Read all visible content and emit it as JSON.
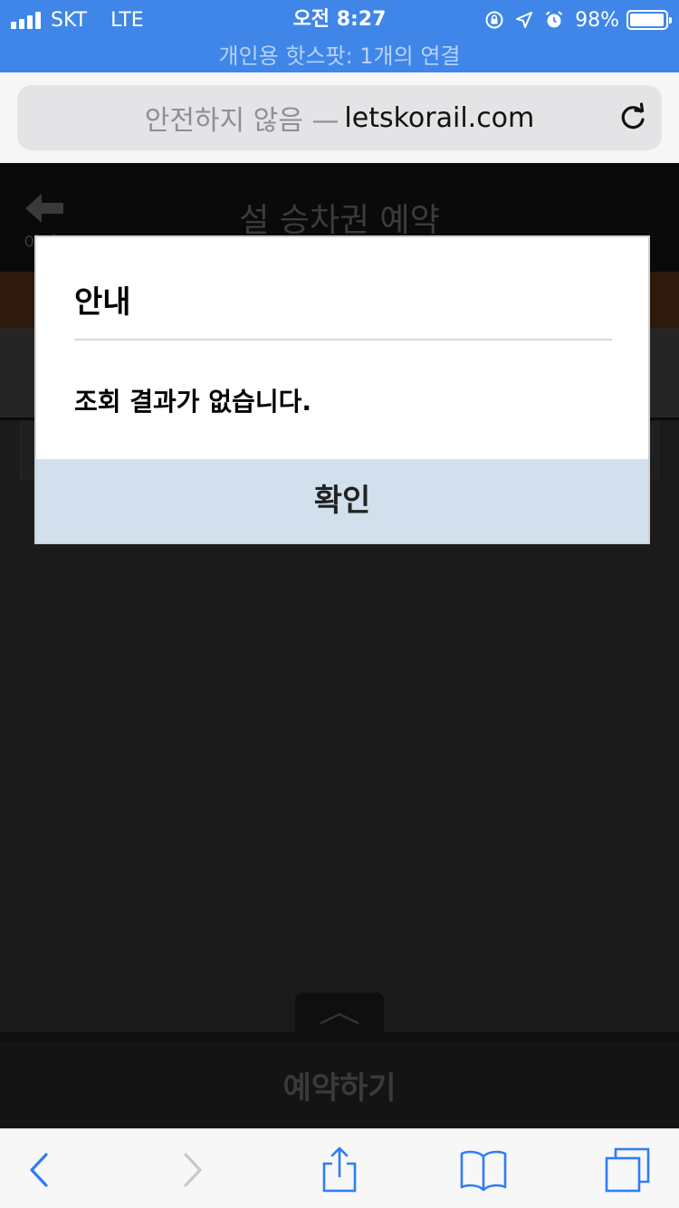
{
  "status_bar": {
    "carrier": "SKT",
    "network": "LTE",
    "time": "오전 8:27",
    "battery": "98%",
    "battery_level": 0.98,
    "hotspot": "개인용 핫스팟: 1개의 연결"
  },
  "address_bar": {
    "insecure_label": "안전하지 않음 —",
    "domain": "letskorail.com",
    "reload_icon": "reload-icon"
  },
  "page": {
    "back_label": "이전",
    "title": "설 승차권 예약",
    "reserve_button": "예약하기"
  },
  "dialog": {
    "title": "안내",
    "message": "조회 결과가 없습니다.",
    "confirm_label": "확인"
  },
  "toolbar": {
    "back_icon": "chevron-left-icon",
    "forward_icon": "chevron-right-icon",
    "share_icon": "share-icon",
    "bookmarks_icon": "book-icon",
    "tabs_icon": "tabs-icon"
  },
  "colors": {
    "status_bar": "#3f86e8",
    "dialog_button": "#d1e0ec",
    "toolbar_active": "#2f7cf6",
    "toolbar_disabled": "#c7c7cc"
  }
}
